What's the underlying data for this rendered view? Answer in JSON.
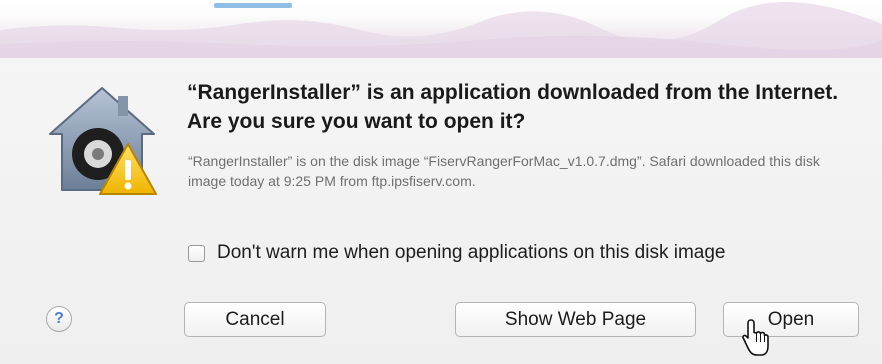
{
  "dialog": {
    "title": "“RangerInstaller” is an application downloaded from the Internet. Are you sure you want to open it?",
    "info": "“RangerInstaller” is on the disk image “FiservRangerForMac_v1.0.7.dmg”. Safari downloaded this disk image today at 9:25 PM from ftp.ipsfiserv.com.",
    "checkbox_label": "Don't warn me when opening applications on this disk image",
    "checkbox_checked": false,
    "help_label": "?",
    "icon": "gatekeeper-warning-icon",
    "buttons": {
      "cancel": "Cancel",
      "show_web_page": "Show Web Page",
      "open": "Open"
    }
  },
  "colors": {
    "warning_yellow": "#f5c51e",
    "help_blue": "#4c7ed6",
    "title_text": "#1a1a1a",
    "info_text": "#6f6f6f"
  }
}
